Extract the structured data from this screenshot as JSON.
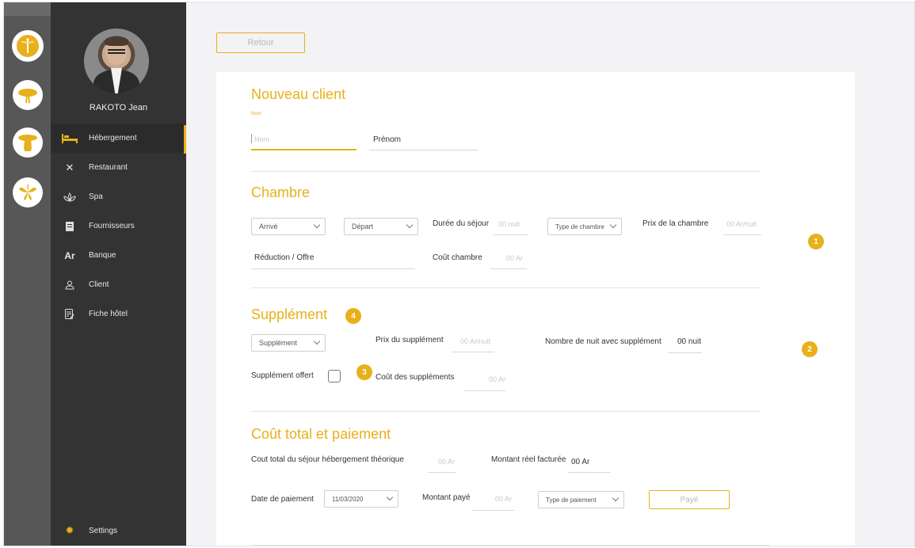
{
  "colors": {
    "accent": "#e8b01a",
    "sidebar": "#333333",
    "rail": "#575757"
  },
  "rail": [
    {
      "name": "palm-tree-icon",
      "active": true
    },
    {
      "name": "acacia-tree-icon",
      "active": false
    },
    {
      "name": "baobab-tree-icon",
      "active": false
    },
    {
      "name": "flower-icon",
      "active": false
    }
  ],
  "user": {
    "name": "RAKOTO Jean"
  },
  "nav": [
    {
      "label": "Hébergement",
      "icon": "bed-icon",
      "active": true
    },
    {
      "label": "Restaurant",
      "icon": "utensils-icon",
      "active": false
    },
    {
      "label": "Spa",
      "icon": "spa-icon",
      "active": false
    },
    {
      "label": "Fournisseurs",
      "icon": "receipt-icon",
      "active": false
    },
    {
      "label": "Banque",
      "icon": "bank-icon",
      "active": false
    },
    {
      "label": "Client",
      "icon": "user-icon",
      "active": false
    },
    {
      "label": "Fiche hôtel",
      "icon": "document-icon",
      "active": false
    }
  ],
  "settings": {
    "label": "Settings"
  },
  "back_button": "Retour",
  "client": {
    "title": "Nouveau client",
    "nom_label": "Nom",
    "nom_placeholder": "Nom",
    "prenom_label": "Prénom"
  },
  "chambre": {
    "title": "Chambre",
    "arrive": "Arrivé",
    "depart": "Départ",
    "duree_label": "Durée du séjour",
    "duree_value": "00 nuit",
    "type_chambre": "Type de chambre",
    "prix_label": "Prix de la chambre",
    "prix_value": "00 Ar/nuit",
    "reduction_label": "Réduction / Offre",
    "cout_label": "Coût chambre",
    "cout_value": "00 Ar"
  },
  "supplement": {
    "title": "Supplément",
    "select": "Supplément",
    "prix_label": "Prix du supplément",
    "prix_value": "00 Ar/nuit",
    "nuits_label": "Nombre de nuit avec supplément",
    "nuits_value": "00 nuit",
    "offert_label": "Supplément offert",
    "cout_label": "Coût des suppléments",
    "cout_value": "00 Ar"
  },
  "paiement": {
    "title": "Coût total et paiement",
    "cout_total_label": "Cout total du séjour hébergement théorique",
    "cout_total_value": "00 Ar",
    "montant_reel_label": "Montant réel facturée",
    "montant_reel_value": "00 Ar",
    "date_label": "Date de paiement",
    "date_value": "11/03/2020",
    "montant_paye_label": "Montant payé",
    "montant_paye_value": "00 Ar",
    "type_paiement": "Type de paiement",
    "paye_button": "Payé"
  },
  "badges": [
    "1",
    "2",
    "3",
    "4"
  ]
}
